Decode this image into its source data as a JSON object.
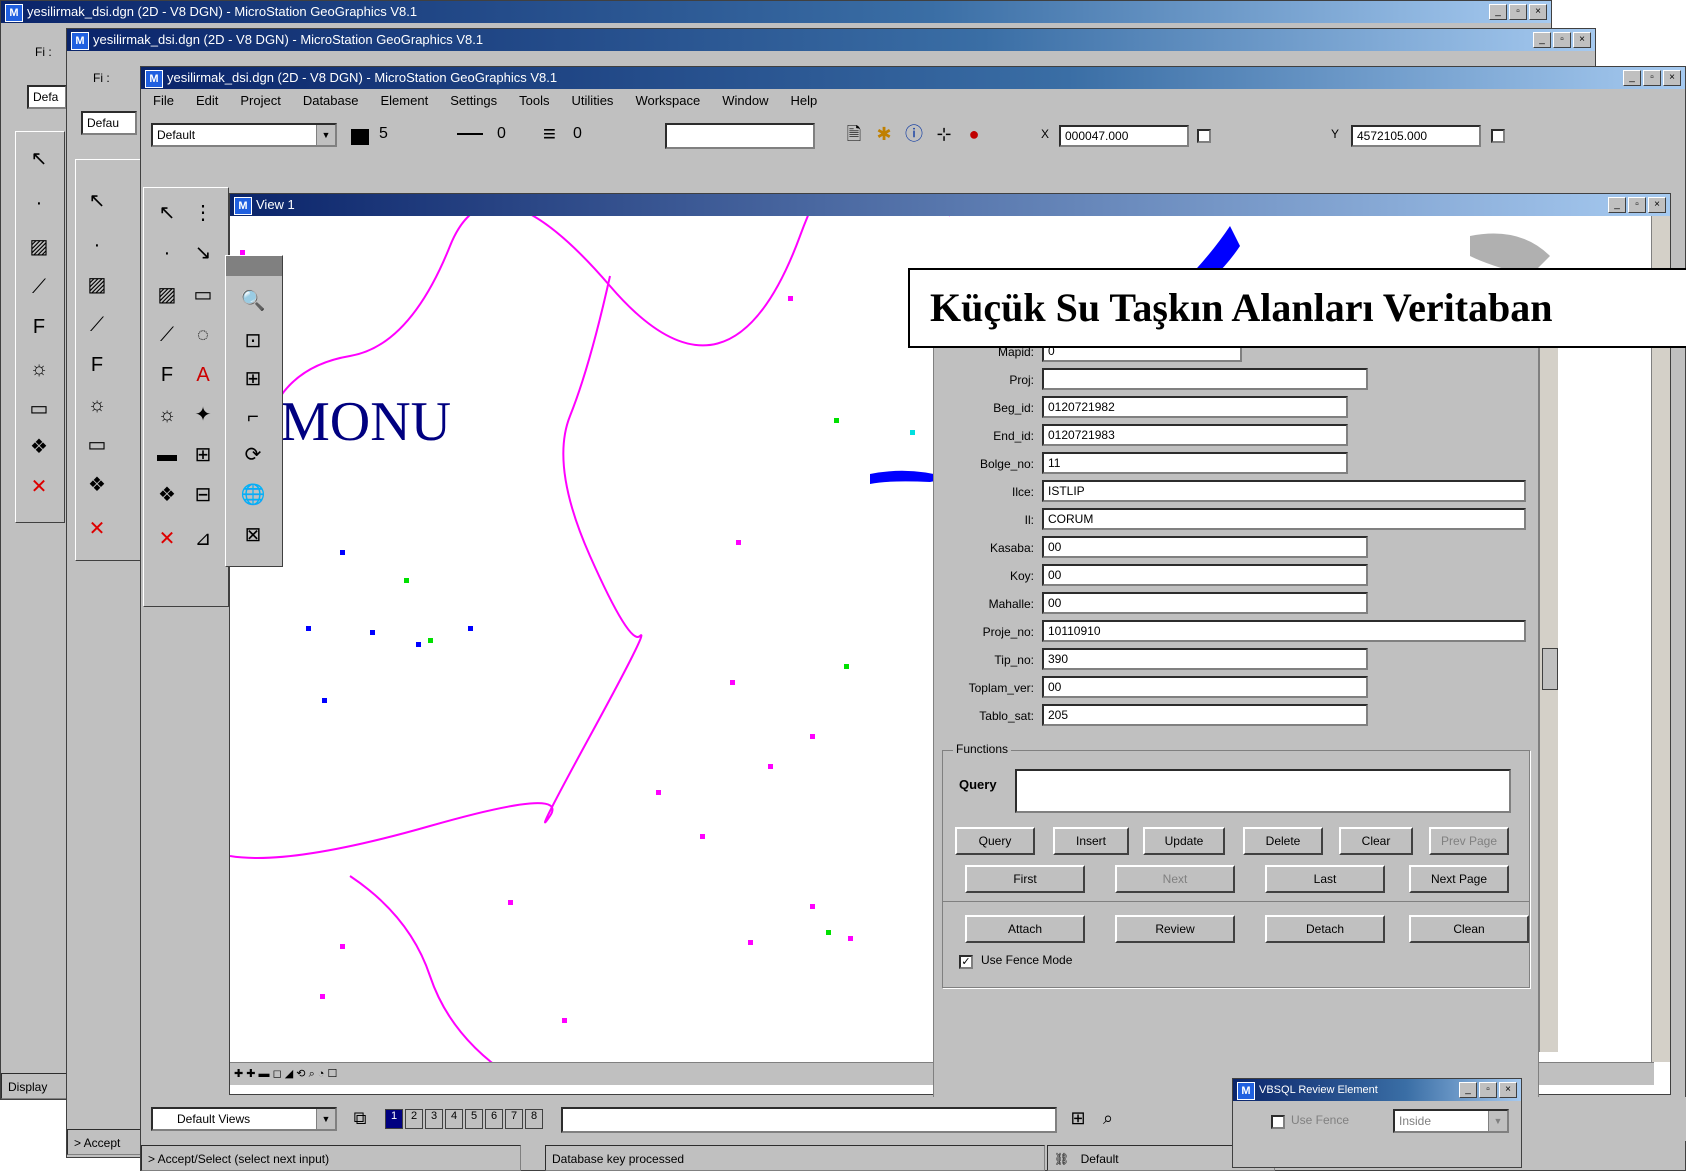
{
  "window": {
    "title": "yesilirmak_dsi.dgn (2D - V8 DGN) - MicroStation GeoGraphics V8.1",
    "controls": [
      "_",
      "▫",
      "×"
    ],
    "menu": [
      "File",
      "Edit",
      "Project",
      "Database",
      "Element",
      "Settings",
      "Tools",
      "Utilities",
      "Workspace",
      "Window",
      "Help"
    ],
    "level_combo": "Default",
    "color_value": "5",
    "style_value": "0",
    "weight_value": "0",
    "x_label": "X",
    "x_value": "000047.000",
    "y_label": "Y",
    "y_value": "4572105.000"
  },
  "bg_window_1": {
    "title": "yesilirmak_dsi.dgn (2D - V8 DGN) - MicroStation GeoGraphics V8.1",
    "combo": "Defa",
    "status": "Display",
    "menu_hint": "Fi :"
  },
  "bg_window_2": {
    "title": "yesilirmak_dsi.dgn (2D - V8 DGN) - MicroStation GeoGraphics V8.1",
    "combo": "Defau",
    "status": "> Accept",
    "menu_hint": "Fi :"
  },
  "view": {
    "title": "View 1",
    "map_label": "MONU"
  },
  "overlay_title": "Küçük Su Taşkın Alanları Veritaban",
  "form": {
    "fields": [
      {
        "label": "Mapid:",
        "value": "0"
      },
      {
        "label": "Proj:",
        "value": ""
      },
      {
        "label": "Beg_id:",
        "value": "0120721982"
      },
      {
        "label": "End_id:",
        "value": "0120721983"
      },
      {
        "label": "Bolge_no:",
        "value": "11"
      },
      {
        "label": "Ilce:",
        "value": "ISTLIP"
      },
      {
        "label": "Il:",
        "value": "CORUM"
      },
      {
        "label": "Kasaba:",
        "value": "00"
      },
      {
        "label": "Koy:",
        "value": "00"
      },
      {
        "label": "Mahalle:",
        "value": "00"
      },
      {
        "label": "Proje_no:",
        "value": "10110910"
      },
      {
        "label": "Tip_no:",
        "value": "390"
      },
      {
        "label": "Toplam_ver:",
        "value": "00"
      },
      {
        "label": "Tablo_sat:",
        "value": "205"
      }
    ],
    "group_label": "Functions",
    "query_label": "Query",
    "query_value": "",
    "buttons_row1": [
      "Query",
      "Insert",
      "Update",
      "Delete",
      "Clear",
      "Prev Page"
    ],
    "buttons_row2": [
      "First",
      "Next",
      "Last",
      "Next Page"
    ],
    "buttons_row3": [
      "Attach",
      "Review",
      "Detach",
      "Clean"
    ],
    "use_fence_label": "Use Fence Mode",
    "use_fence_checked": "✓"
  },
  "view_bar": {
    "combo": "Default Views",
    "view_numbers": [
      "1",
      "2",
      "3",
      "4",
      "5",
      "6",
      "7",
      "8"
    ]
  },
  "fence_dialog": {
    "title": "VBSQL Review Element",
    "checkbox_label": "Use Fence",
    "combo": "Inside"
  },
  "status": {
    "prompt": "> Accept/Select (select next input)",
    "message": "Database key processed",
    "level": "Default"
  }
}
